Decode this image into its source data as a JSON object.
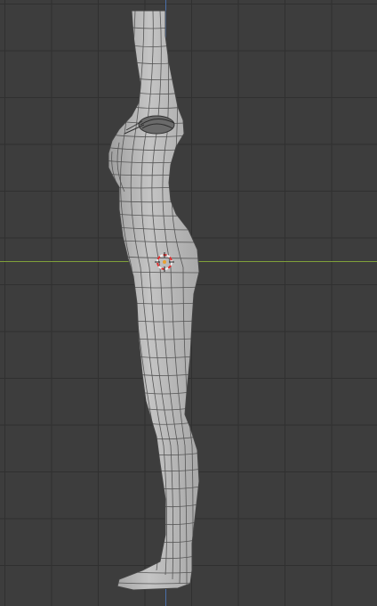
{
  "viewport": {
    "name": "3D Viewport",
    "colors": {
      "background": "#3d3d3d",
      "grid": "#303030",
      "x_axis": "#7fa03a",
      "z_axis": "#4a6fa8",
      "mesh_fill": "#b4b4b4",
      "mesh_wire": "#555555",
      "cursor_red": "#e03030",
      "cursor_white": "#f0f0f0"
    },
    "object": {
      "icon": "mesh-object",
      "mode": "wireframe-overlay"
    },
    "cursor_icon": "3d-cursor-icon",
    "origin_icon": "object-origin-icon"
  }
}
